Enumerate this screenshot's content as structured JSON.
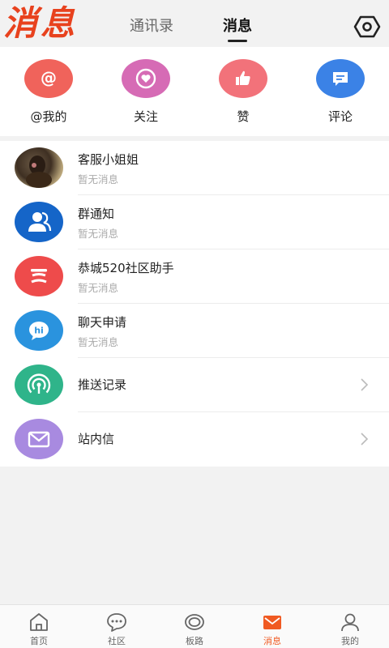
{
  "header": {
    "logo_text": "消息",
    "tabs": [
      {
        "label": "通讯录",
        "active": false
      },
      {
        "label": "消息",
        "active": true
      }
    ]
  },
  "quick_actions": [
    {
      "label": "@我的",
      "icon": "at-icon",
      "color": "#f0635b"
    },
    {
      "label": "关注",
      "icon": "heart-icon",
      "color": "#d66bb5"
    },
    {
      "label": "赞",
      "icon": "thumbs-up-icon",
      "color": "#f2727a"
    },
    {
      "label": "评论",
      "icon": "comment-icon",
      "color": "#3b82e6"
    }
  ],
  "messages": [
    {
      "title": "客服小姐姐",
      "subtitle": "暂无消息",
      "icon": "photo-avatar"
    },
    {
      "title": "群通知",
      "subtitle": "暂无消息",
      "icon": "group-icon",
      "color": "#1565c8"
    },
    {
      "title": "恭城520社区助手",
      "subtitle": "暂无消息",
      "icon": "assistant-icon",
      "color": "#ee4b4b"
    },
    {
      "title": "聊天申请",
      "subtitle": "暂无消息",
      "icon": "hi-chat-icon",
      "color": "#2a93de"
    },
    {
      "title": "推送记录",
      "icon": "broadcast-icon",
      "color": "#2fb48a"
    },
    {
      "title": "站内信",
      "icon": "mail-icon",
      "color": "#a88ae0"
    }
  ],
  "bottom_nav": [
    {
      "label": "首页",
      "icon": "home-icon",
      "active": false
    },
    {
      "label": "社区",
      "icon": "chat-bubble-icon",
      "active": false
    },
    {
      "label": "板路",
      "icon": "ring-icon",
      "active": false
    },
    {
      "label": "消息",
      "icon": "envelope-icon",
      "active": true
    },
    {
      "label": "我的",
      "icon": "user-icon",
      "active": false
    }
  ],
  "colors": {
    "accent": "#f05a22",
    "background": "#f2f2f2"
  }
}
